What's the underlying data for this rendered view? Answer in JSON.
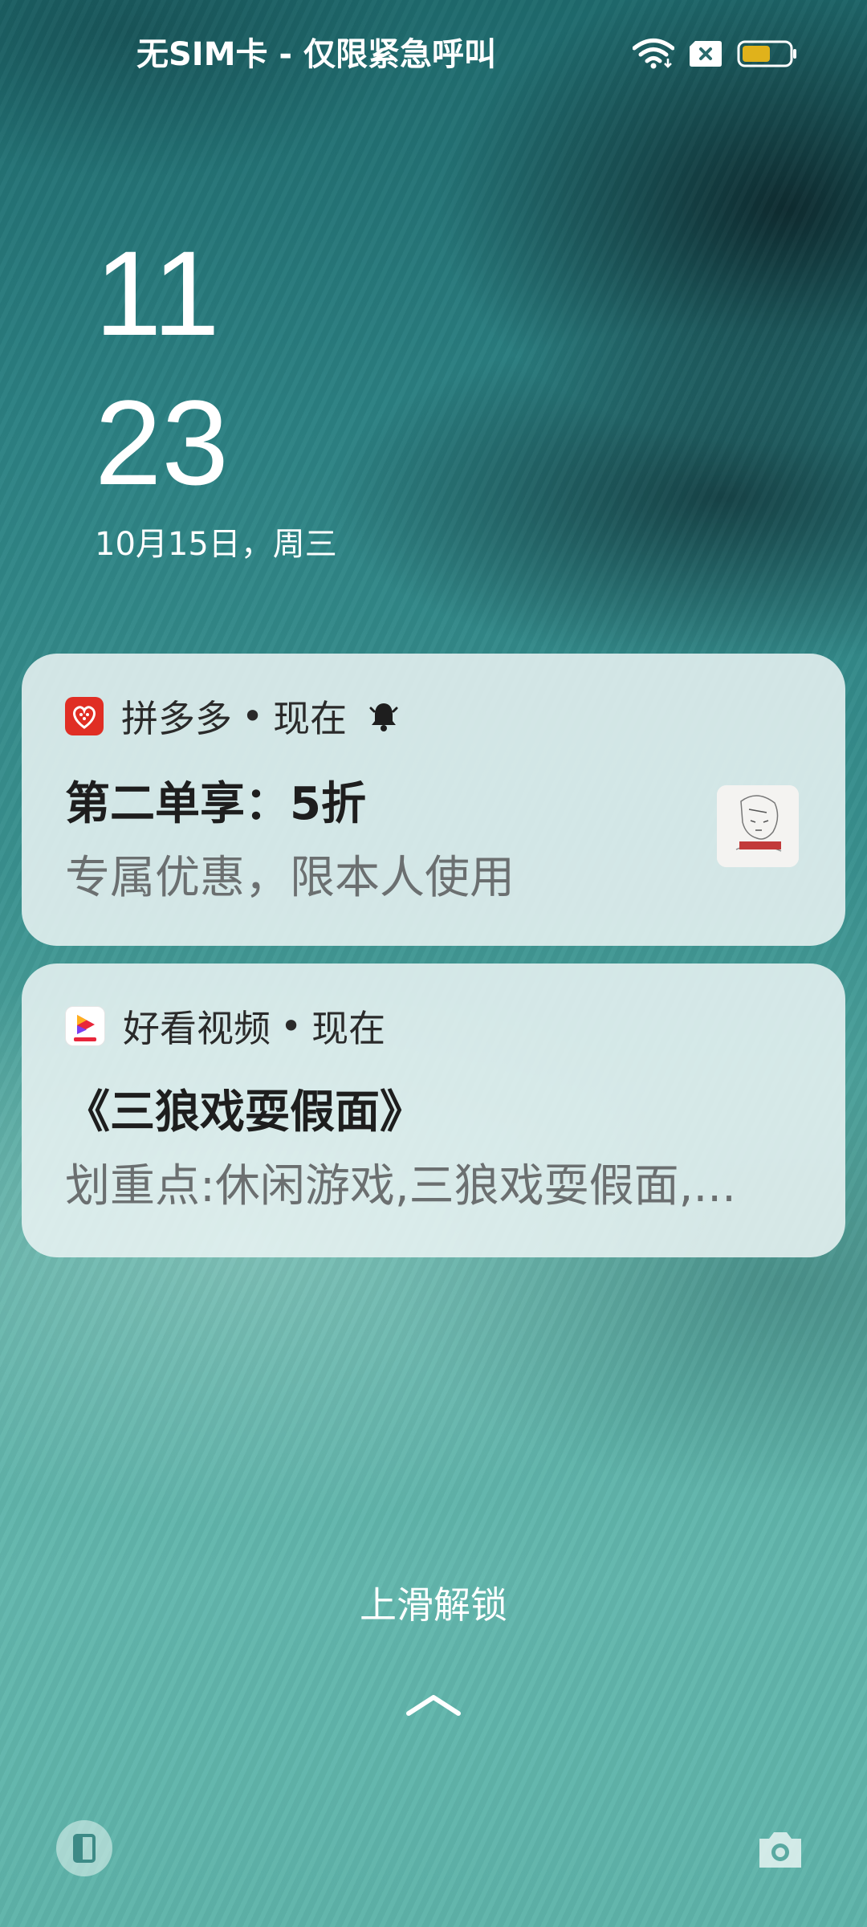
{
  "status_bar": {
    "carrier_text": "无SIM卡 - 仅限紧急呼叫",
    "icons": [
      "wifi-icon",
      "no-sim-icon",
      "battery-icon"
    ],
    "battery_color": "#e0b21b"
  },
  "lockscreen": {
    "hour": "11",
    "minute": "23",
    "date": "10月15日，周三",
    "unlock_hint": "上滑解锁"
  },
  "notifications": [
    {
      "app": "拼多多",
      "time": "现在",
      "title": "第二单享：5折",
      "body": "专属优惠，限本人使用",
      "icon": "pinduoduo-app-icon",
      "has_alert_bell": true,
      "has_thumbnail": true
    },
    {
      "app": "好看视频",
      "time": "现在",
      "title": "《三狼戏耍假面》",
      "body": "划重点:休闲游戏,三狼戏耍假面,...",
      "icon": "haokan-video-app-icon",
      "has_alert_bell": false,
      "has_thumbnail": false
    }
  ],
  "shortcuts": {
    "left": "wallet-icon",
    "right": "camera-icon"
  },
  "colors": {
    "pinduoduo_red": "#e02e24",
    "card_bg": "#e8f2f2"
  }
}
